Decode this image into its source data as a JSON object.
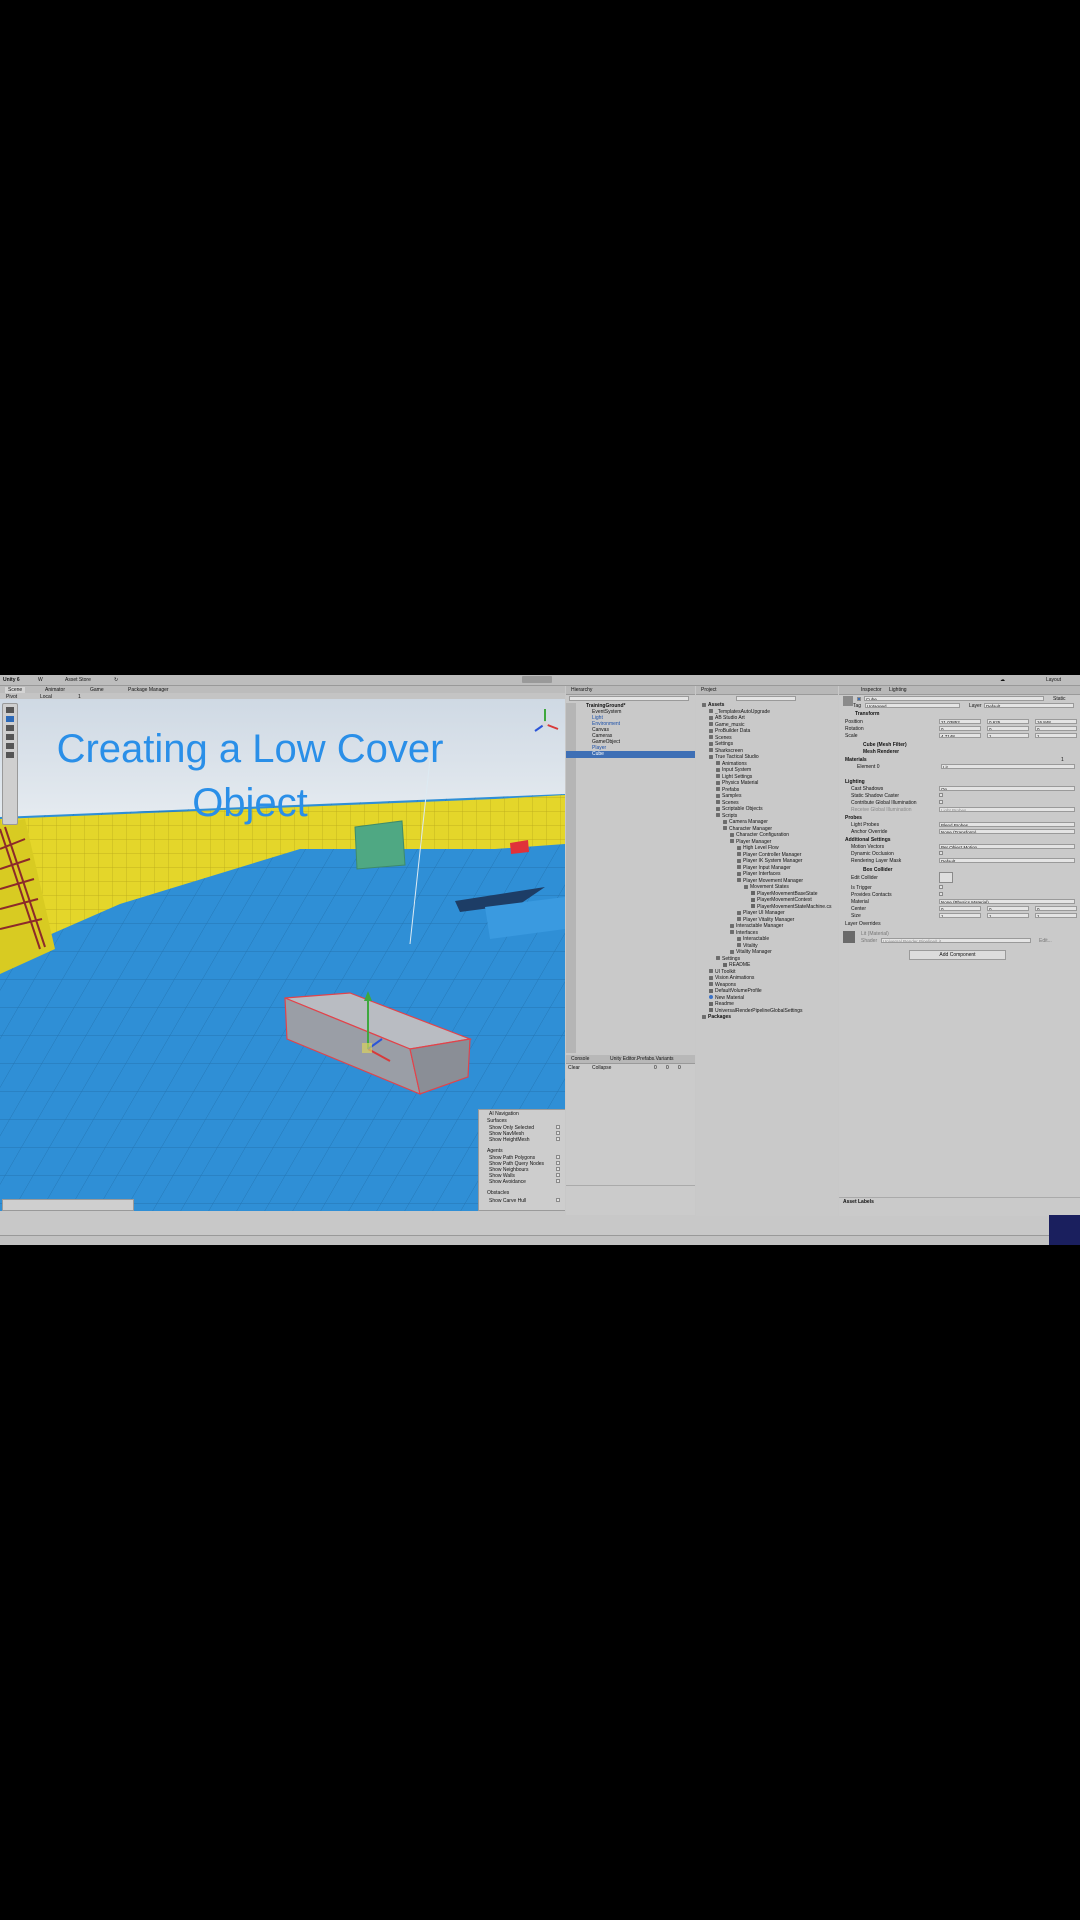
{
  "topbar": {
    "app_label": "Unity 6",
    "account_label": "W",
    "asset_store_label": "Asset Store",
    "cloud_label": "☁",
    "layout_label": "Layout"
  },
  "scene_tabs": {
    "scene": "Scene",
    "animator": "Animator",
    "game": "Game",
    "package_manager": "Package Manager"
  },
  "scene_toolbar": {
    "pivot": "Pivot",
    "local": "Local",
    "grid_value": "1"
  },
  "overlay_title": {
    "line1": "Creating a Low Cover",
    "line2": "Object"
  },
  "ai_nav": {
    "header": "AI Navigation",
    "surfaces": "Surfaces",
    "show_only_selected": "Show Only Selected",
    "show_navmesh": "Show NavMesh",
    "show_heightmesh": "Show HeightMesh",
    "agents": "Agents",
    "show_path_polygons": "Show Path Polygons",
    "show_path_query_nodes": "Show Path Query Nodes",
    "show_neighbours": "Show Neighbours",
    "show_walls": "Show Walls",
    "show_avoidance": "Show Avoidance",
    "obstacles": "Obstacles",
    "show_carve_hull": "Show Carve Hull"
  },
  "hierarchy": {
    "tab": "Hierarchy",
    "scene_name": "TrainingGround*",
    "items": [
      "EventSystem",
      "Light",
      "Environment",
      "Canvas",
      "Cameras",
      "GameObject",
      "Player",
      "Cube"
    ]
  },
  "console": {
    "tab_console": "Console",
    "tab_prefab": "Unity Editor.Prefabs.Variants",
    "clear": "Clear",
    "collapse": "Collapse",
    "count_log": "0",
    "count_warn": "0",
    "count_err": "0"
  },
  "project": {
    "tab": "Project",
    "root": "Assets",
    "items": [
      "_TemplatesAutoUpgrade",
      "AB Studio Art",
      "Game_music",
      "ProBuilder Data",
      "Scenes",
      "Settings",
      "Sharkscreen",
      "True Tactical Studio",
      "Animations",
      "Input System",
      "Light Settings",
      "Physics Material",
      "Prefabs",
      "Samples",
      "Scenes",
      "Scriptable Objects",
      "Scripts",
      "Camera Manager",
      "Character Manager",
      "Character Configuration",
      "Player Manager",
      "High Level Flow",
      "Player Controller Manager",
      "Player IK System Manager",
      "Player Input Manager",
      "Player Interfaces",
      "Player Movement Manager",
      "Movement States",
      "PlayerMovementBaseState",
      "PlayerMovementContext",
      "PlayerMovementStateMachine.cs",
      "Player UI Manager",
      "Player Vitality Manager",
      "Interactable Manager",
      "Interfaces",
      "Interactable",
      "Vitality",
      "Vitality Manager",
      "Settings",
      "README",
      "UI Toolkit",
      "Vision Animations",
      "Weapons",
      "DefaultVolumeProfile",
      "New Material",
      "Readme",
      "UniversalRenderPipelineGlobalSettings",
      "Packages"
    ]
  },
  "inspector": {
    "tab_inspector": "Inspector",
    "tab_lighting": "Lighting",
    "object_name": "Cube",
    "static_label": "Static",
    "tag_label": "Tag",
    "tag_value": "Untagged",
    "layer_label": "Layer",
    "layer_value": "Default",
    "transform": "Transform",
    "position": "Position",
    "rotation": "Rotation",
    "scale": "Scale",
    "pos_x": "21.03852",
    "pos_y": "0.625",
    "pos_z": "16.848",
    "rot_x": "0",
    "rot_y": "0",
    "rot_z": "0",
    "scale_x": "4.7148",
    "scale_y": "1",
    "scale_z": "1",
    "mesh_filter": "Cube (Mesh Filter)",
    "mesh_renderer": "Mesh Renderer",
    "materials": "Materials",
    "materials_count": "1",
    "element0": "Element 0",
    "element0_value": "Lit",
    "lighting": "Lighting",
    "cast_shadows": "Cast Shadows",
    "cast_shadows_value": "On",
    "static_shadow_caster": "Static Shadow Caster",
    "contribute_gi": "Contribute Global Illumination",
    "receive_gi": "Receive Global Illumination",
    "receive_gi_value": "Light Probes",
    "probes": "Probes",
    "light_probes": "Light Probes",
    "light_probes_value": "Blend Probes",
    "anchor_override": "Anchor Override",
    "anchor_override_value": "None (Transform)",
    "additional_settings": "Additional Settings",
    "motion_vectors": "Motion Vectors",
    "motion_vectors_value": "Per Object Motion",
    "dynamic_occlusion": "Dynamic Occlusion",
    "rendering_layer_mask": "Rendering Layer Mask",
    "rendering_layer_value": "Default",
    "box_collider": "Box Collider",
    "edit_collider": "Edit Collider",
    "is_trigger": "Is Trigger",
    "provides_contacts": "Provides Contacts",
    "material": "Material",
    "material_value": "None (Physics Material)",
    "center": "Center",
    "size": "Size",
    "center_x": "0",
    "center_y": "0",
    "center_z": "0",
    "size_x": "1",
    "size_y": "1",
    "size_z": "1",
    "layer_overrides": "Layer Overrides",
    "lit_material": "Lit (Material)",
    "shader_label": "Shader",
    "shader_value": "Universal Render Pipeline/Lit",
    "edit_label": "Edit...",
    "add_component": "Add Component",
    "asset_labels": "Asset Labels"
  },
  "colors": {
    "title_blue": "#2a8fe8",
    "selection_blue": "#3e6fb5",
    "floor_blue": "#2f8fd6",
    "wall_yellow": "#e4d62a"
  }
}
